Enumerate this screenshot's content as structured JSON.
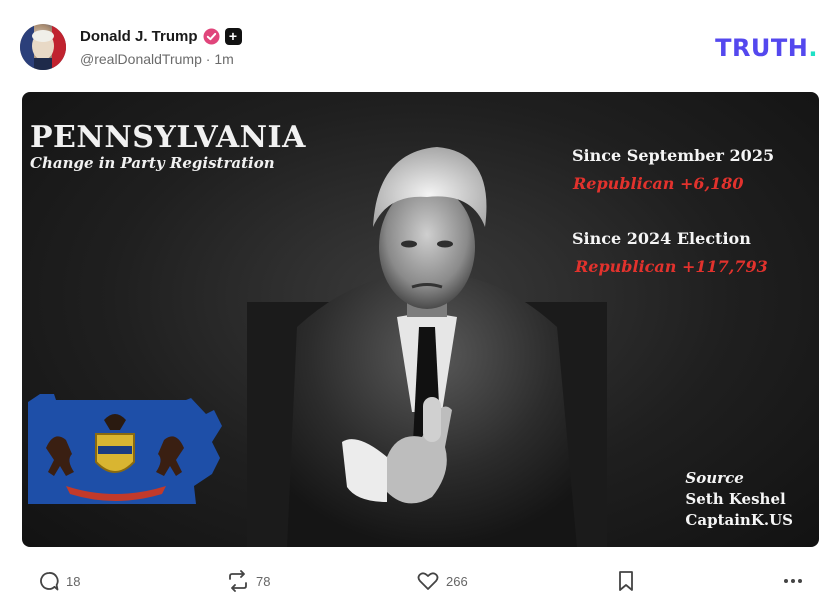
{
  "post": {
    "author": {
      "display_name": "Donald J. Trump",
      "handle": "@realDonaldTrump",
      "separator": "·",
      "time": "1m",
      "verified_color": "#e0457b"
    },
    "logo": {
      "text": "TRUTH",
      "dot": ".",
      "color": "#5448ee",
      "dot_color": "#1fe0c5"
    },
    "image": {
      "title": "PENNSYLVANIA",
      "subtitle": "Change in Party Registration",
      "stats": [
        {
          "label": "Since September 2025",
          "value": "Republican +6,180"
        },
        {
          "label": "Since 2024 Election",
          "value": "Republican +117,793"
        }
      ],
      "source": {
        "heading": "Source",
        "line1": "Seth Keshel",
        "line2": "CaptainK.US"
      },
      "accent_red": "#e2322d"
    },
    "actions": {
      "reply_count": "18",
      "retruth_count": "78",
      "like_count": "266"
    }
  }
}
